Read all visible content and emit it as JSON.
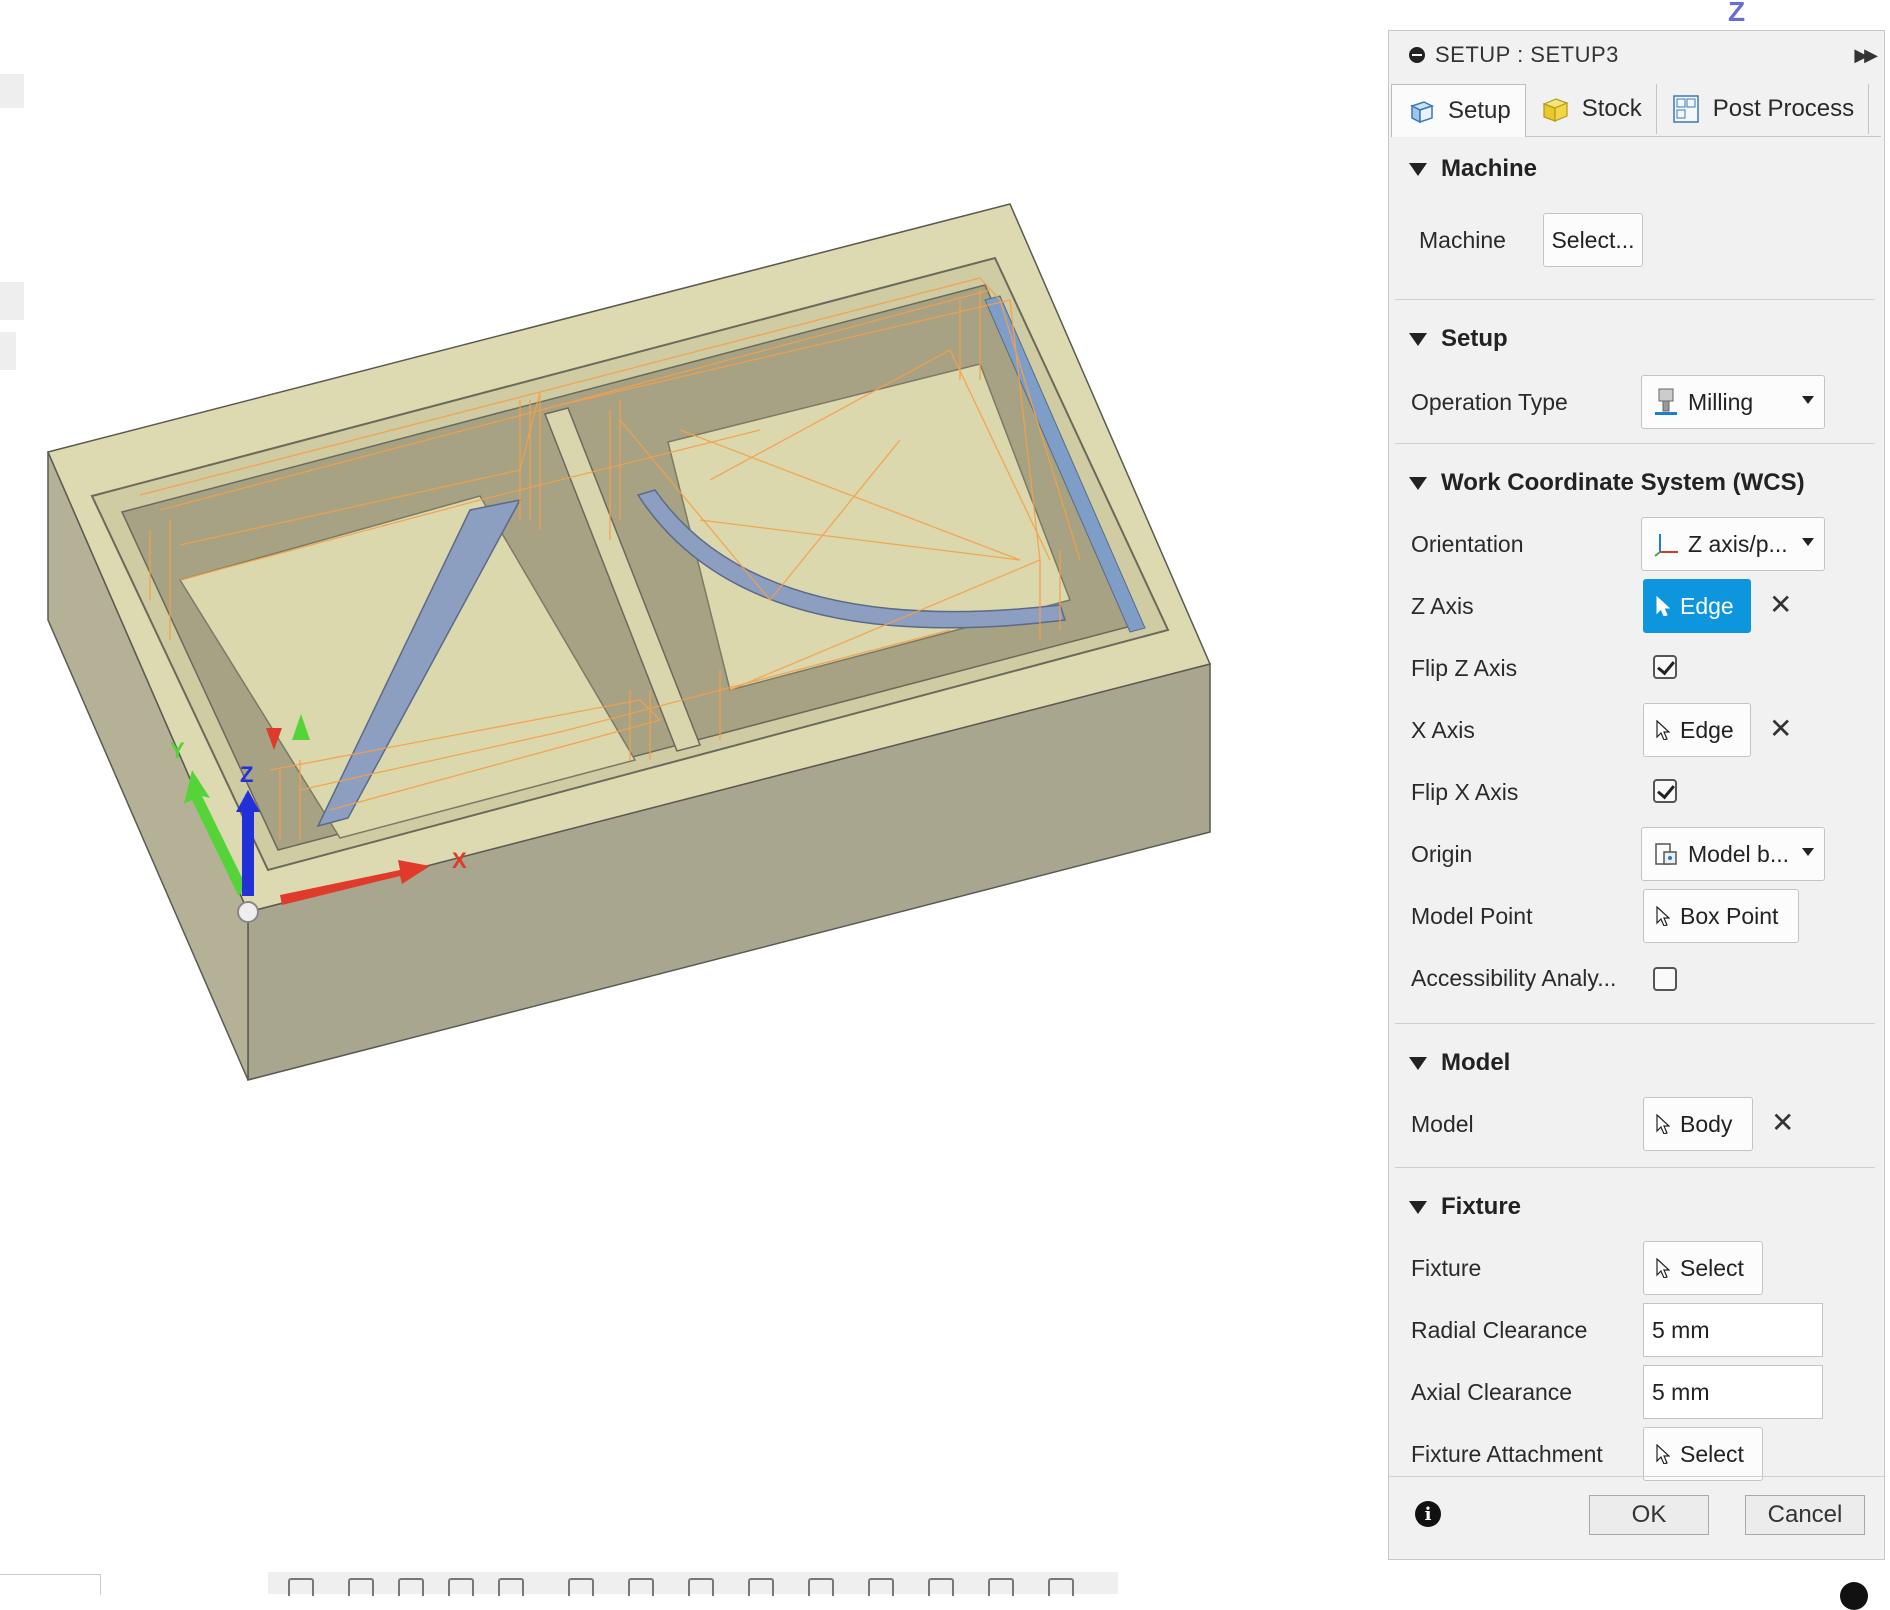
{
  "viewcube": {
    "z_label": "Z"
  },
  "axes": {
    "x_label": "X",
    "y_label": "Y",
    "z_label": "Z"
  },
  "colors": {
    "accent": "#0d96de",
    "stock_top": "#ddd9b0",
    "stock_side": "#aaa68e",
    "toolpath": "#f5a04a",
    "x_axis": "#e03a2a",
    "y_axis": "#55d43a",
    "z_axis": "#2230d8"
  },
  "panel": {
    "title": "SETUP : SETUP3",
    "tabs": [
      {
        "label": "Setup",
        "icon": "setup-cube-icon"
      },
      {
        "label": "Stock",
        "icon": "stock-box-icon"
      },
      {
        "label": "Post Process",
        "icon": "gcode-icon"
      }
    ],
    "machine": {
      "section": "Machine",
      "label": "Machine",
      "button": "Select..."
    },
    "setup": {
      "section": "Setup",
      "op_label": "Operation Type",
      "op_value": "Milling"
    },
    "wcs": {
      "section": "Work Coordinate System (WCS)",
      "orientation_label": "Orientation",
      "orientation_value": "Z axis/p...",
      "z_axis_label": "Z Axis",
      "z_axis_value": "Edge",
      "flip_z_label": "Flip Z Axis",
      "flip_z": true,
      "x_axis_label": "X Axis",
      "x_axis_value": "Edge",
      "flip_x_label": "Flip X Axis",
      "flip_x": true,
      "origin_label": "Origin",
      "origin_value": "Model b...",
      "model_point_label": "Model Point",
      "model_point_value": "Box Point",
      "access_label": "Accessibility Analy...",
      "access": false
    },
    "model": {
      "section": "Model",
      "label": "Model",
      "value": "Body"
    },
    "fixture": {
      "section": "Fixture",
      "fixture_label": "Fixture",
      "fixture_value": "Select",
      "radial_label": "Radial Clearance",
      "radial_value": "5 mm",
      "axial_label": "Axial Clearance",
      "axial_value": "5 mm",
      "attach_label": "Fixture Attachment",
      "attach_value": "Select"
    },
    "ok": "OK",
    "cancel": "Cancel"
  }
}
